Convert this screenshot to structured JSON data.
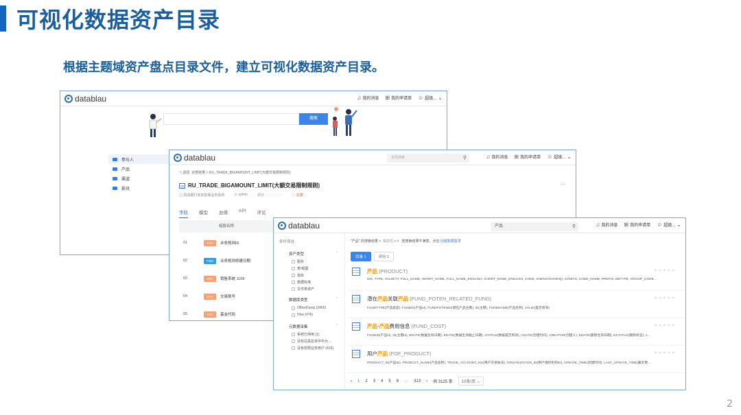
{
  "slide": {
    "title": "可视化数据资产目录",
    "subtitle": "根据主题域资产盘点目录文件，建立可视化数据资产目录。",
    "page_number": "2"
  },
  "app": {
    "logo_text": "datablau",
    "nav": {
      "messages": "我的消息",
      "requests": "我的申请单",
      "user": "超级..."
    }
  },
  "shot1": {
    "search_button": "搜索",
    "side_items": [
      "参与人",
      "产品",
      "渠道",
      "损讯"
    ]
  },
  "shot2": {
    "search_placeholder": "全局搜索",
    "back": "返回",
    "breadcrumb": "全部结果 > RU_TRADE_BIGAMOUNT_LIMIT(大额交易限制规则)",
    "title": "RU_TRADE_BIGAMOUNT_LIMIT(大额交易限制规则)",
    "meta": {
      "system": "风清银行资本担保业务系统",
      "owner": "admin",
      "rating": "评分",
      "favorite": "收藏"
    },
    "tabs": [
      "字段",
      "模型",
      "血缘",
      "API",
      "评论"
    ],
    "table_header": "组段名称",
    "rows": [
      {
        "num": "01",
        "type": "STR",
        "name": "业务规则ID"
      },
      {
        "num": "02",
        "type": "TIME",
        "name": "业务规则修建日期"
      },
      {
        "num": "03",
        "type": "STR",
        "name": "销售系统 1109"
      },
      {
        "num": "04",
        "type": "STR",
        "name": "交易账号"
      },
      {
        "num": "05",
        "type": "STR",
        "name": "基金代码"
      }
    ],
    "colors": {
      "str": "#f4a27a",
      "time": "#3a9bd8"
    }
  },
  "shot3": {
    "search_value": "产品",
    "filter": {
      "title": "条件筛选",
      "groups": [
        {
          "label": "资产类型",
          "options": [
            "服务",
            "表/视图",
            "指标",
            "数据标准",
            "文件类资产"
          ]
        },
        {
          "label": "数据库类型",
          "options": [
            "OfficeDump (2455)",
            "Hive (476)"
          ]
        },
        {
          "label": "元数据采集",
          "options": [
            "系统已停用 (1)",
            "没有在黑名单中中为 ...",
            "没有权限业务用户 (419)"
          ]
        }
      ]
    },
    "result_head": {
      "query": "\"产品\" 的搜索结果",
      "sort": "相关性",
      "hint": "若搜索结果不满意，点击",
      "link": "创建数据需求"
    },
    "tabs": [
      "目录 1",
      "评分 1"
    ],
    "results": [
      {
        "pre": "",
        "hl1": "产品",
        "mid": "",
        "hl2": "",
        "post": " ",
        "en": "(PRODUCT)",
        "desc": "IDS, TYPE, VALIDITY, FULL_NAME, SHORT_NAME, FULL_NAME_ENGLISH, SHORT_NAME_ENGLISH, CODE, SHENGXIAORIQI, CONFIG, CODE_NAME, PREFIX, DBTYPE, GROUP_CODE..."
      },
      {
        "pre": "潜在",
        "hl1": "产品",
        "mid": "关联",
        "hl2": "产品",
        "post": " ",
        "en": "(FUND_POTEN_RELATED_FUND)",
        "desc": "FUNDTYPE(产品类型), FUNDID(产品id), FUNDPOTENID(潜在产品主键), ID(主键), FUNDNAME(产品名称), VALID(是否有效)"
      },
      {
        "pre": "",
        "hl1": "产品",
        "mid": "-",
        "hl2": "产品",
        "post": "费用信息 ",
        "en": "(FUND_COST)",
        "desc": "FUNDID(产品id), ID(主键id), BDATE(数据生效日期), EDATE(数据生效截止日期), STATUS(数据是否有效), CDATE(创建时间), CREATOR(创建人), DDATE(删除生效日期), DSTATUS(删除状态), A..."
      },
      {
        "pre": "用户",
        "hl1": "产品",
        "mid": "",
        "hl2": "",
        "post": " ",
        "en": "(FOF_PRODUCT)",
        "desc": "PRODUCT_ID(产品ID), PRODUCT_NAME(产品名称), TRADE_ACCOUNT_NO(用户交易账号), ORGANIZATION_ID(用户组织机构ID), CREATE_TIME(创建时间), LAST_UPDATE_TIME(最近更..."
      }
    ],
    "pager": {
      "pages": [
        "1",
        "2",
        "3",
        "4",
        "5",
        "6",
        "···",
        "313"
      ],
      "total": "共 3125 条",
      "page_size": "10条/页"
    }
  }
}
